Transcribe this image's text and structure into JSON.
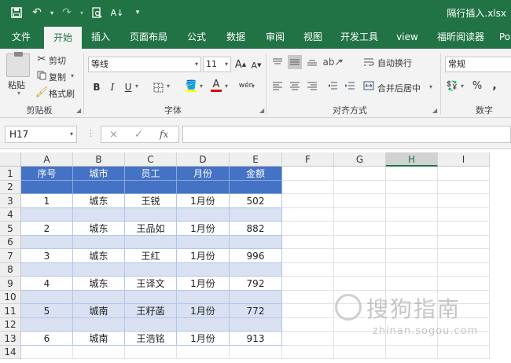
{
  "titlebar": {
    "document_title": "隔行插入.xlsx"
  },
  "tabs": [
    "文件",
    "开始",
    "插入",
    "页面布局",
    "公式",
    "数据",
    "审阅",
    "视图",
    "开发工具",
    "view",
    "福昕阅读器",
    "Po"
  ],
  "active_tab": "开始",
  "ribbon": {
    "clipboard": {
      "paste": "粘贴",
      "cut": "剪切",
      "copy": "复制",
      "format_painter": "格式刷",
      "label": "剪贴板"
    },
    "font": {
      "font_name": "等线",
      "font_size": "11",
      "label": "字体",
      "bold": "B",
      "italic": "I",
      "underline": "U",
      "grow": "A",
      "shrink": "A",
      "phonetic": "wén"
    },
    "alignment": {
      "wrap_text": "自动换行",
      "merge_center": "合并后居中",
      "label": "对齐方式"
    },
    "number": {
      "format": "常规",
      "percent": "%",
      "comma": ",",
      "label": "数字"
    }
  },
  "formula_bar": {
    "name_box": "H17",
    "cancel": "×",
    "enter": "✓",
    "fx": "fx",
    "content": ""
  },
  "sheet": {
    "columns": [
      "A",
      "B",
      "C",
      "D",
      "E",
      "F",
      "G",
      "H",
      "I"
    ],
    "selected_column": "H",
    "rows": [
      "1",
      "2",
      "3",
      "4",
      "5",
      "6",
      "7",
      "8",
      "9",
      "10",
      "11",
      "12",
      "13",
      "14"
    ],
    "table_headers": [
      "序号",
      "城市",
      "员工",
      "月份",
      "金额"
    ],
    "records": [
      [
        "1",
        "城东",
        "王锐",
        "1月份",
        "502"
      ],
      [
        "2",
        "城东",
        "王品如",
        "1月份",
        "882"
      ],
      [
        "3",
        "城东",
        "王红",
        "1月份",
        "996"
      ],
      [
        "4",
        "城东",
        "王译文",
        "1月份",
        "792"
      ],
      [
        "5",
        "城南",
        "王籽菡",
        "1月份",
        "772"
      ],
      [
        "6",
        "城南",
        "王浩铭",
        "1月份",
        "913"
      ]
    ]
  },
  "watermark": {
    "text": "搜狗指南",
    "url": "zhinan.sogou.com"
  },
  "colors": {
    "brand": "#217346",
    "table_header": "#4472c4",
    "band": "#d9e1f2"
  }
}
